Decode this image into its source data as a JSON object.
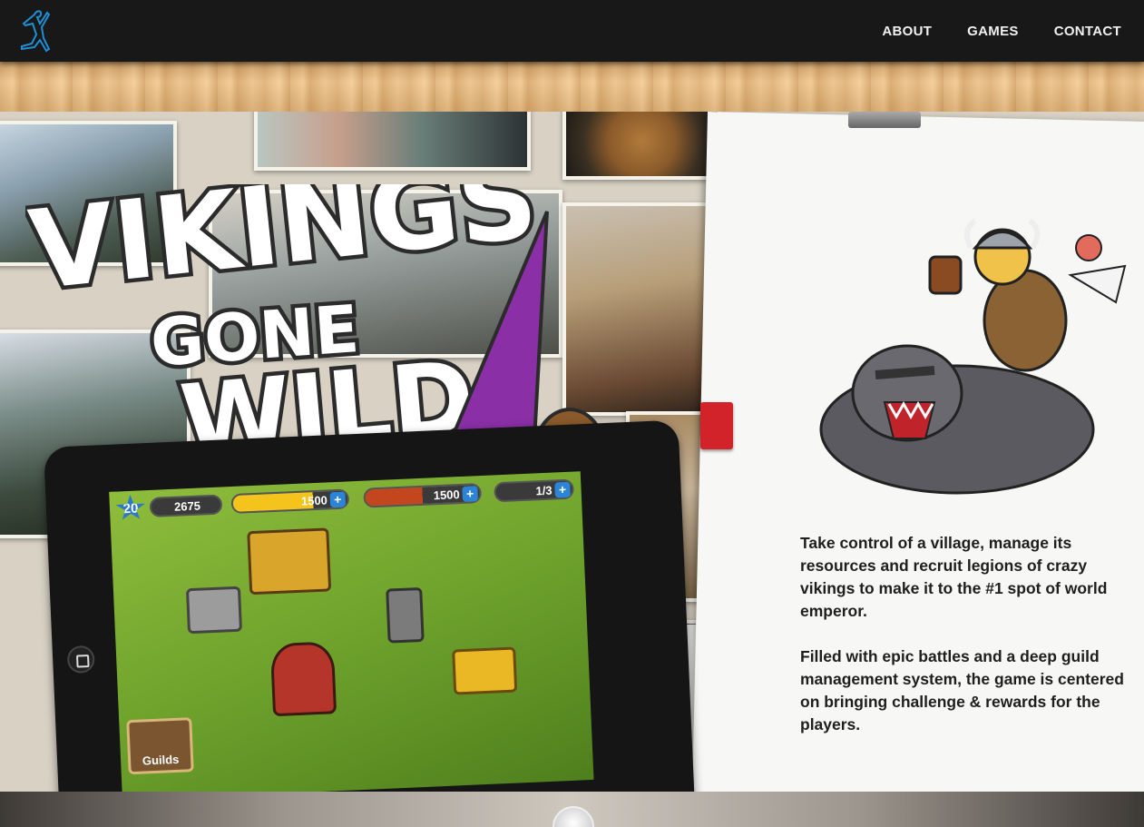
{
  "nav": {
    "logo_icon": "jumping-figure-logo-icon",
    "items": [
      {
        "label": "ABOUT"
      },
      {
        "label": "GAMES"
      },
      {
        "label": "CONTACT"
      }
    ]
  },
  "hero": {
    "title_art": "VIKINGS GONE WILD",
    "game_hud": {
      "level": "20",
      "xp": "2675",
      "gold": "1500",
      "meat": "1500",
      "workers": "1/3",
      "guilds_label": "Guilds"
    },
    "description": [
      "Take control of a village, manage its resources and recruit legions of crazy vikings to make it to the #1 spot of world emperor.",
      "Filled with epic battles and a deep guild management system, the game is centered on bringing challenge & rewards for the players."
    ]
  },
  "colors": {
    "topbar": "#181818",
    "accent_blue": "#1f8fd6",
    "text": "#1e1e1e"
  }
}
